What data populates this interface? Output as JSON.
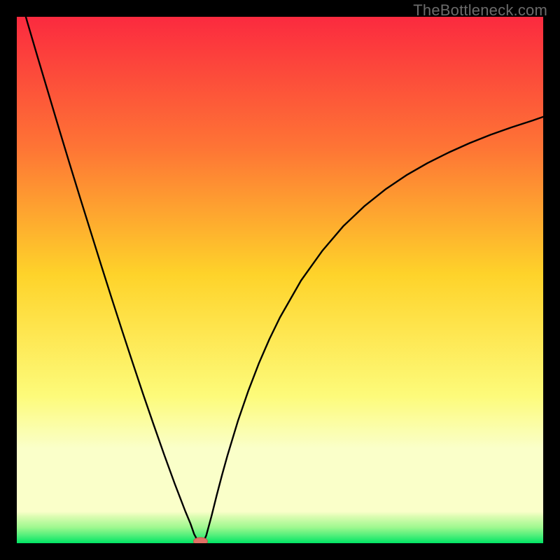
{
  "watermark": "TheBottleneck.com",
  "colors": {
    "frame": "#000000",
    "grad_top": "#fb2a3f",
    "grad_mid_upper": "#fe7535",
    "grad_mid": "#fed32a",
    "grad_lower": "#fdfb7a",
    "grad_band": "#faffc9",
    "grad_green_light": "#9ef88f",
    "grad_green": "#00e564",
    "curve": "#000000",
    "marker_fill": "#e17065",
    "marker_stroke": "#c5584e"
  },
  "chart_data": {
    "type": "line",
    "title": "",
    "xlabel": "",
    "ylabel": "",
    "xlim": [
      0,
      100
    ],
    "ylim": [
      0,
      100
    ],
    "x": [
      0,
      2,
      4,
      6,
      8,
      10,
      12,
      14,
      16,
      18,
      20,
      22,
      24,
      26,
      28,
      30,
      31,
      32,
      33,
      33.7,
      34.3,
      34.8,
      35,
      35.5,
      36,
      37,
      38,
      39,
      40,
      42,
      44,
      46,
      48,
      50,
      54,
      58,
      62,
      66,
      70,
      74,
      78,
      82,
      86,
      90,
      94,
      98,
      100
    ],
    "values": [
      106,
      99,
      92.2,
      85.5,
      78.8,
      72.2,
      65.7,
      59.3,
      52.9,
      46.6,
      40.4,
      34.3,
      28.3,
      22.5,
      16.8,
      11.3,
      8.7,
      6.1,
      3.7,
      1.7,
      0.6,
      0.16,
      0.1,
      0.32,
      1.5,
      5.2,
      9.2,
      13.0,
      16.6,
      23.2,
      29.0,
      34.2,
      38.8,
      42.9,
      49.9,
      55.5,
      60.2,
      64.0,
      67.2,
      69.9,
      72.2,
      74.2,
      76.0,
      77.6,
      79.0,
      80.3,
      81.0
    ],
    "annotations": [
      {
        "kind": "marker",
        "x": 34.9,
        "y": 0.35
      }
    ]
  }
}
